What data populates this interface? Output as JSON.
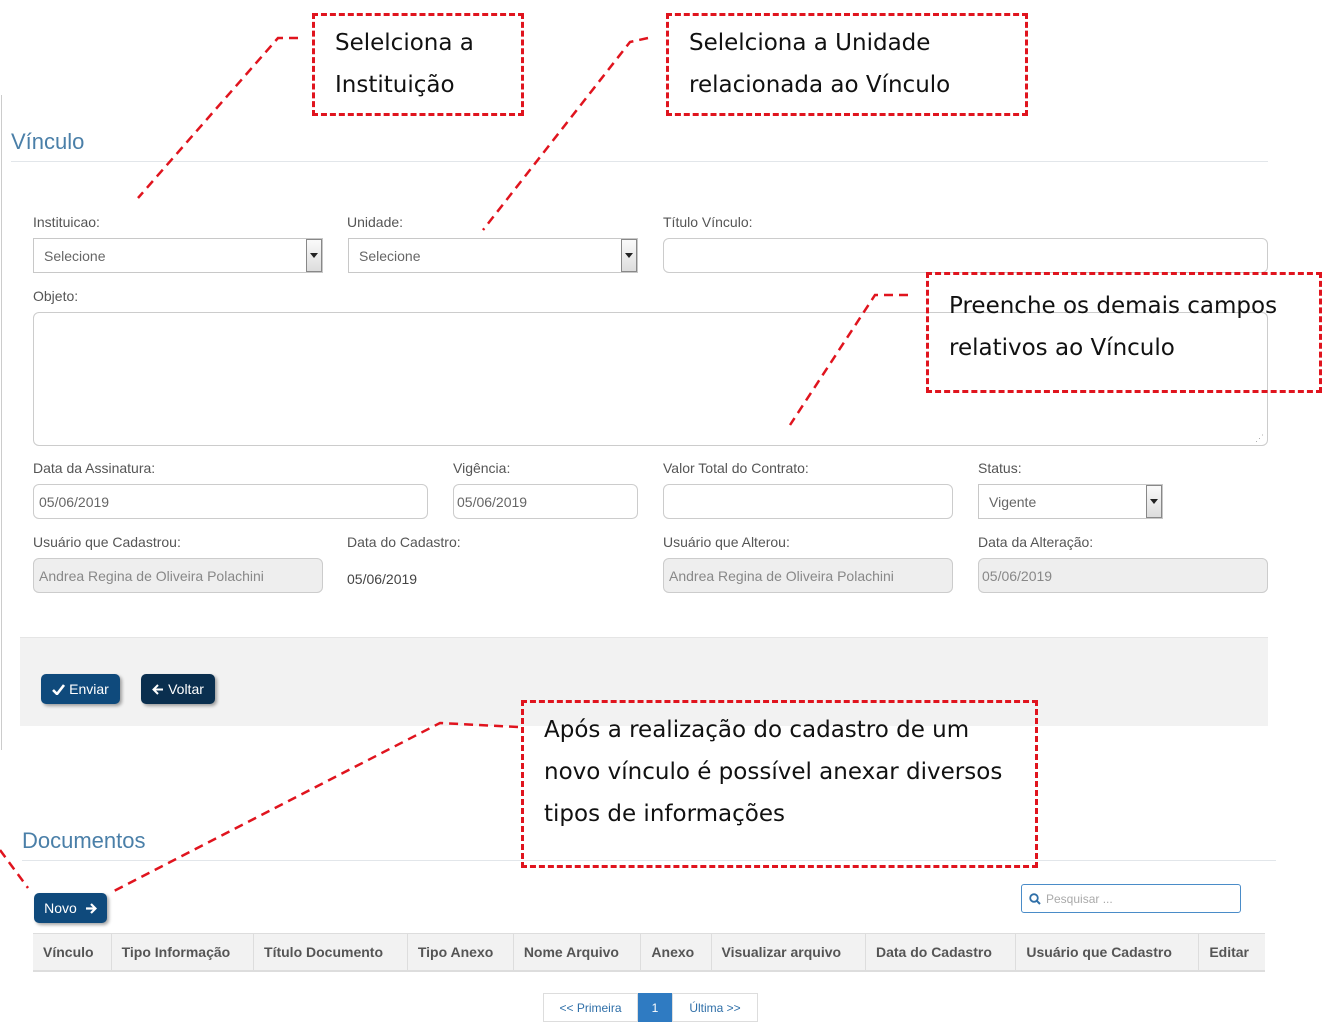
{
  "callouts": {
    "instituicao": [
      "Selelciona a",
      "Instituição"
    ],
    "unidade": [
      "Selelciona a Unidade",
      "relacionada ao Vínculo"
    ],
    "demais": [
      "Preenche os demais campos",
      "relativos ao Vínculo"
    ],
    "anexar": [
      "Após a realização do cadastro de um",
      "novo vínculo é possível anexar diversos",
      "tipos de informações"
    ]
  },
  "vinculo": {
    "heading": "Vínculo",
    "instituicao": {
      "label": "Instituicao:",
      "value": "Selecione"
    },
    "unidade": {
      "label": "Unidade:",
      "value": "Selecione"
    },
    "titulo": {
      "label": "Título Vínculo:",
      "value": ""
    },
    "objeto": {
      "label": "Objeto:",
      "value": ""
    },
    "data_assinatura": {
      "label": "Data da Assinatura:",
      "value": "05/06/2019"
    },
    "vigencia": {
      "label": "Vigência:",
      "value": "05/06/2019"
    },
    "valor_total": {
      "label": "Valor Total do Contrato:",
      "value": ""
    },
    "status": {
      "label": "Status:",
      "value": "Vigente"
    },
    "usuario_cadastrou": {
      "label": "Usuário que Cadastrou:",
      "value": "Andrea Regina de Oliveira Polachini"
    },
    "data_cadastro": {
      "label": "Data do Cadastro:",
      "value": "05/06/2019"
    },
    "usuario_alterou": {
      "label": "Usuário que Alterou:",
      "value": "Andrea Regina de Oliveira Polachini"
    },
    "data_alteracao": {
      "label": "Data da Alteração:",
      "value": "05/06/2019"
    },
    "buttons": {
      "enviar": "Enviar",
      "voltar": "Voltar"
    }
  },
  "documentos": {
    "heading": "Documentos",
    "novo_label": "Novo",
    "search_placeholder": "Pesquisar ...",
    "columns": [
      "Vínculo",
      "Tipo Informação",
      "Título Documento",
      "Tipo Anexo",
      "Nome Arquivo",
      "Anexo",
      "Visualizar arquivo",
      "Data do Cadastro",
      "Usuário que Cadastro",
      "Editar"
    ],
    "pagination": {
      "first": "<< Primeira",
      "current": "1",
      "last": "Última >>"
    }
  },
  "colors": {
    "accent": "#0f4a7c",
    "callout_border": "#e0141e",
    "heading": "#4a7fa8"
  }
}
